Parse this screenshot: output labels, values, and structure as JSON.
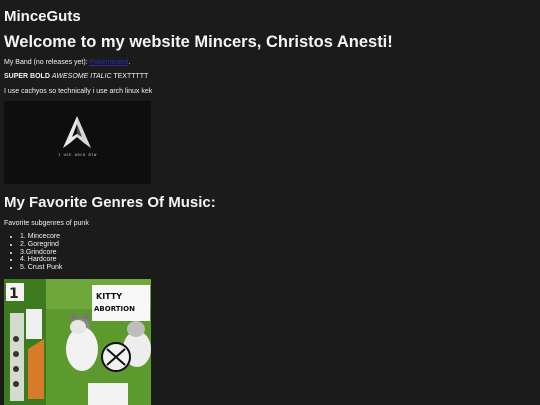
{
  "site": {
    "title": "MinceGuts"
  },
  "welcome": {
    "heading": "Welcome to my website Mincers, Christos Anesti!"
  },
  "band": {
    "prefix": "My Band (no releases yet): ",
    "link_text": "Pokeminded",
    "suffix": "."
  },
  "style_demo": {
    "bold": "SUPER BOLD",
    "italic": "AWESOME ITALIC",
    "plain": "TEXTTTTT"
  },
  "distro": {
    "text": "I use cachyos so technically i use arch linux kek"
  },
  "arch_image": {
    "caption": "I USE ARCH BTW",
    "icon": "arch-linux-logo-icon"
  },
  "genres": {
    "heading": "My Favorite Genres Of Music:",
    "subtitle": "Favorite subgenres of punk",
    "items": [
      "1. Mincecore",
      "2. Goregrind",
      "3.Grindcore",
      "4. Hardcore",
      "5. Crust Punk"
    ]
  },
  "album_art": {
    "text": "KITTY KITTY ABORTION",
    "icon": "album-cover-cats"
  },
  "colors": {
    "background": "#1c1b1c",
    "text": "#f2f2f2",
    "link": "#2a2aa8"
  }
}
